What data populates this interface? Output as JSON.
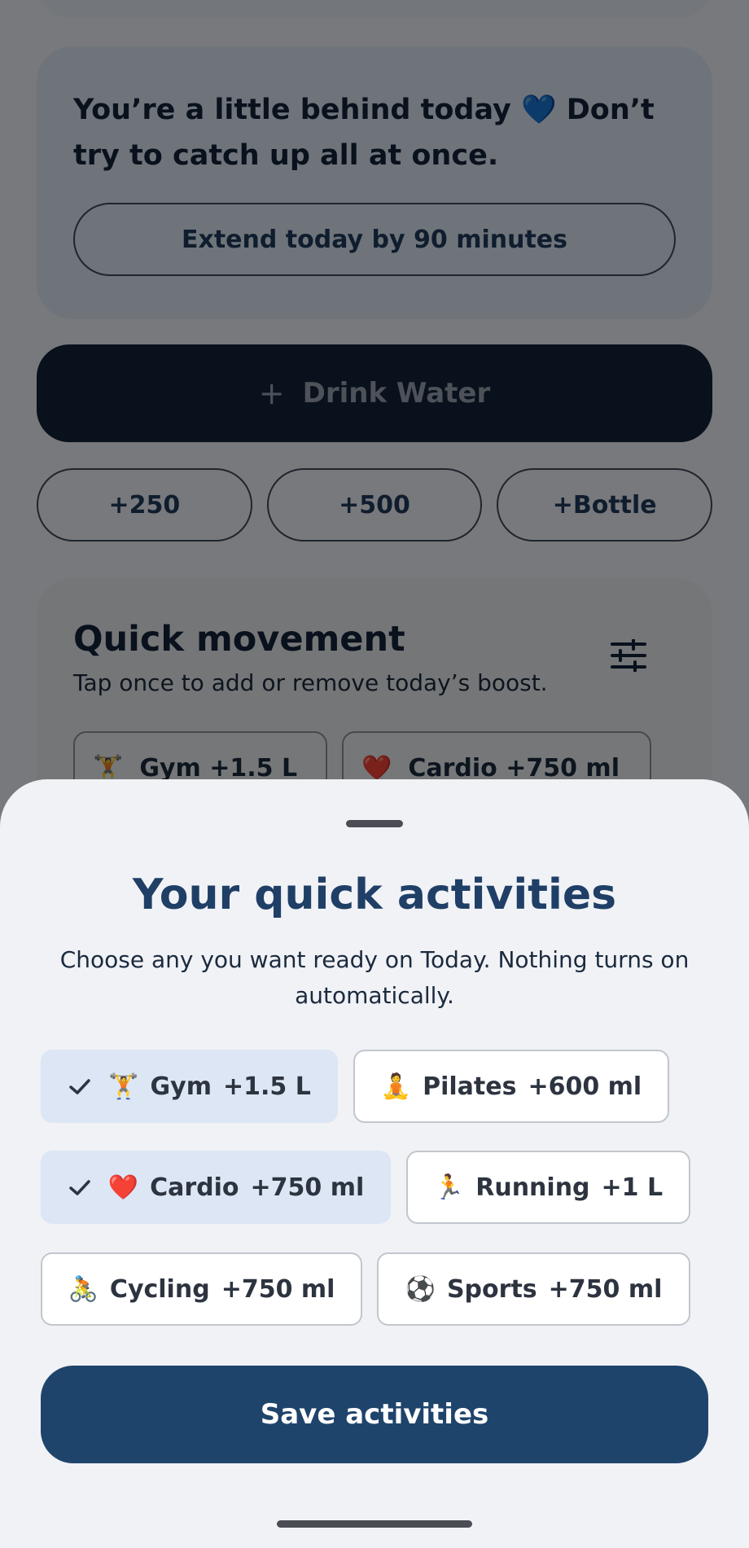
{
  "background": {
    "behind_card": {
      "message": "You’re a little behind today 💙 Don’t try to catch up all at once.",
      "extend_label": "Extend today by 90 minutes"
    },
    "drink_button": {
      "plus": "+",
      "label": "Drink Water"
    },
    "amount_buttons": [
      "+250",
      "+500",
      "+Bottle"
    ],
    "quick_movement": {
      "title": "Quick movement",
      "subtitle": "Tap once to add or remove today’s boost.",
      "chips": [
        {
          "emoji": "🏋️",
          "label": "Gym  +1.5 L"
        },
        {
          "emoji": "❤️",
          "label": "Cardio  +750 ml"
        }
      ]
    }
  },
  "sheet": {
    "title": "Your quick activities",
    "subtitle": "Choose any you want ready on Today. Nothing turns on automatically.",
    "activities": [
      {
        "emoji": "🏋️",
        "name": "Gym",
        "amount": "+1.5 L",
        "selected": true
      },
      {
        "emoji": "🧘",
        "name": "Pilates",
        "amount": "+600 ml",
        "selected": false
      },
      {
        "emoji": "❤️",
        "name": "Cardio",
        "amount": "+750 ml",
        "selected": true
      },
      {
        "emoji": "🏃",
        "name": "Running",
        "amount": "+1 L",
        "selected": false
      },
      {
        "emoji": "🚴",
        "name": "Cycling",
        "amount": "+750 ml",
        "selected": false
      },
      {
        "emoji": "⚽",
        "name": "Sports",
        "amount": "+750 ml",
        "selected": false
      }
    ],
    "save_label": "Save activities"
  },
  "colors": {
    "primary": "#1f446b",
    "dark_button": "#13233a",
    "selected_chip": "#dce6f4",
    "title": "#1f3f66"
  }
}
